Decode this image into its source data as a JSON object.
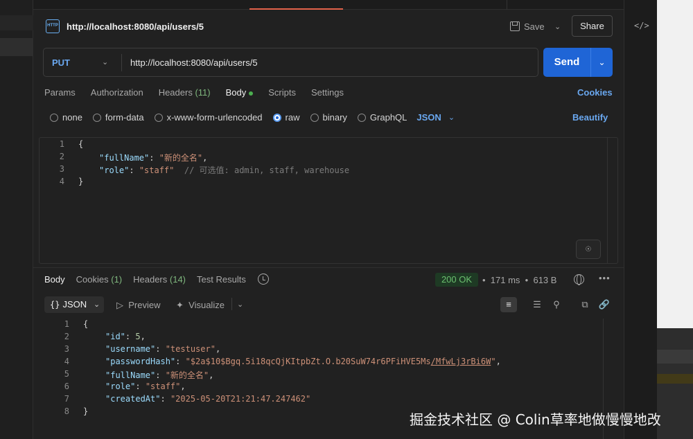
{
  "request": {
    "title": "http://localhost:8080/api/users/5",
    "save_label": "Save",
    "share_label": "Share",
    "method": "PUT",
    "url": "http://localhost:8080/api/users/5",
    "send_label": "Send"
  },
  "req_tabs": {
    "params": "Params",
    "authorization": "Authorization",
    "headers": "Headers",
    "headers_count": "(11)",
    "body": "Body",
    "scripts": "Scripts",
    "settings": "Settings",
    "cookies": "Cookies"
  },
  "body_types": {
    "none": "none",
    "form_data": "form-data",
    "urlencoded": "x-www-form-urlencoded",
    "raw": "raw",
    "binary": "binary",
    "graphql": "GraphQL",
    "format": "JSON",
    "beautify": "Beautify",
    "selected": "raw"
  },
  "request_body": {
    "line_numbers": [
      "1",
      "2",
      "3",
      "4"
    ],
    "l1": "{",
    "l2_key": "\"fullName\"",
    "l2_val": "\"新的全名\"",
    "l3_key": "\"role\"",
    "l3_val": "\"staff\"",
    "l3_comment": "// 可选值: admin, staff, warehouse",
    "l4": "}"
  },
  "res_tabs": {
    "body": "Body",
    "cookies": "Cookies",
    "cookies_count": "(1)",
    "headers": "Headers",
    "headers_count": "(14)",
    "test_results": "Test Results"
  },
  "response_meta": {
    "status": "200 OK",
    "time": "171 ms",
    "size": "613 B"
  },
  "res_toolbar": {
    "format": "JSON",
    "preview": "Preview",
    "visualize": "Visualize"
  },
  "response_body": {
    "line_numbers": [
      "1",
      "2",
      "3",
      "4",
      "5",
      "6",
      "7",
      "8"
    ],
    "open": "{",
    "id_key": "\"id\"",
    "id_val": "5",
    "username_key": "\"username\"",
    "username_val": "\"testuser\"",
    "hash_key": "\"passwordHash\"",
    "hash_val_a": "\"$2a$10$Bgq.5i18qcQjKItpbZt.O.b20SuW74r6PFiHVE5Ms",
    "hash_val_b": "/MfwLj3rBi6W",
    "hash_val_c": "\"",
    "fullname_key": "\"fullName\"",
    "fullname_val": "\"新的全名\"",
    "role_key": "\"role\"",
    "role_val": "\"staff\"",
    "created_key": "\"createdAt\"",
    "created_val": "\"2025-05-20T21:21:47.247462\"",
    "close": "}"
  },
  "watermark": "掘金技术社区 @ Colin草率地做慢慢地改",
  "colors": {
    "accent": "#1f65d6",
    "link": "#6aa8f0",
    "status_ok": "#6cc070",
    "tab_active": "#e2624a"
  },
  "icons": [
    "http-icon",
    "save-icon",
    "chevron-down-icon",
    "code-icon",
    "history-icon",
    "globe-icon",
    "more-icon",
    "wrap-icon",
    "filter-icon",
    "search-icon",
    "copy-icon",
    "link-icon",
    "play-icon",
    "visualize-icon",
    "ai-icon"
  ]
}
